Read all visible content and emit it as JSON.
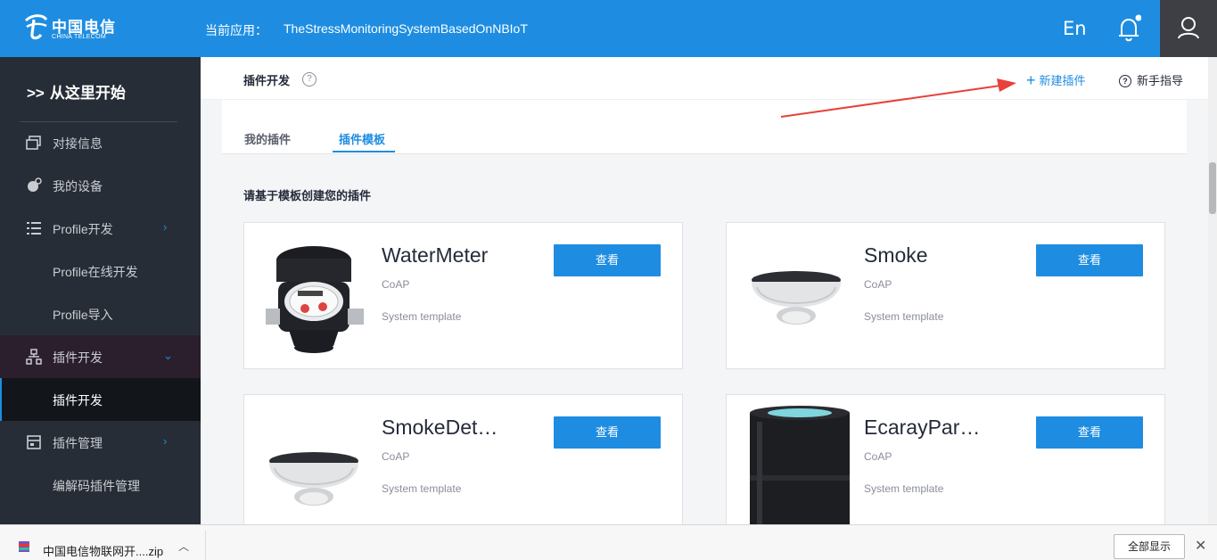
{
  "brand": {
    "logo_cn": "中国电信",
    "logo_en": "CHINA TELECOM"
  },
  "topbar": {
    "app_label": "当前应用：",
    "app_name": "TheStressMonitoringSystemBasedOnNBIoT",
    "lang_label": "En"
  },
  "sidebar": {
    "start_label": "从这里开始",
    "items": [
      {
        "label": "对接信息",
        "icon": "window-icon"
      },
      {
        "label": "我的设备",
        "icon": "device-icon"
      },
      {
        "label": "Profile开发",
        "icon": "list-icon"
      },
      {
        "label": "Profile在线开发"
      },
      {
        "label": "Profile导入"
      },
      {
        "label": "插件开发",
        "icon": "hierarchy-icon"
      },
      {
        "label": "插件开发"
      },
      {
        "label": "插件管理",
        "icon": "panel-icon"
      },
      {
        "label": "编解码插件管理"
      }
    ]
  },
  "main": {
    "title": "插件开发",
    "new_plugin_label": "新建插件",
    "guide_label": "新手指导",
    "tabs": [
      {
        "label": "我的插件"
      },
      {
        "label": "插件模板"
      }
    ],
    "section_title": "请基于模板创建您的插件",
    "cards": [
      {
        "name": "WaterMeter",
        "protocol": "CoAP",
        "template": "System template",
        "button": "查看"
      },
      {
        "name": "Smoke",
        "protocol": "CoAP",
        "template": "System template",
        "button": "查看"
      },
      {
        "name": "SmokeDet…",
        "protocol": "CoAP",
        "template": "System template",
        "button": "查看"
      },
      {
        "name": "EcarayPar…",
        "protocol": "CoAP",
        "template": "System template",
        "button": "查看"
      }
    ]
  },
  "download_bar": {
    "file_name": "中国电信物联网开....zip",
    "show_all": "全部显示"
  },
  "colors": {
    "primary": "#1e8de1",
    "sidebar": "#272d36",
    "arrow": "#e8403a"
  }
}
